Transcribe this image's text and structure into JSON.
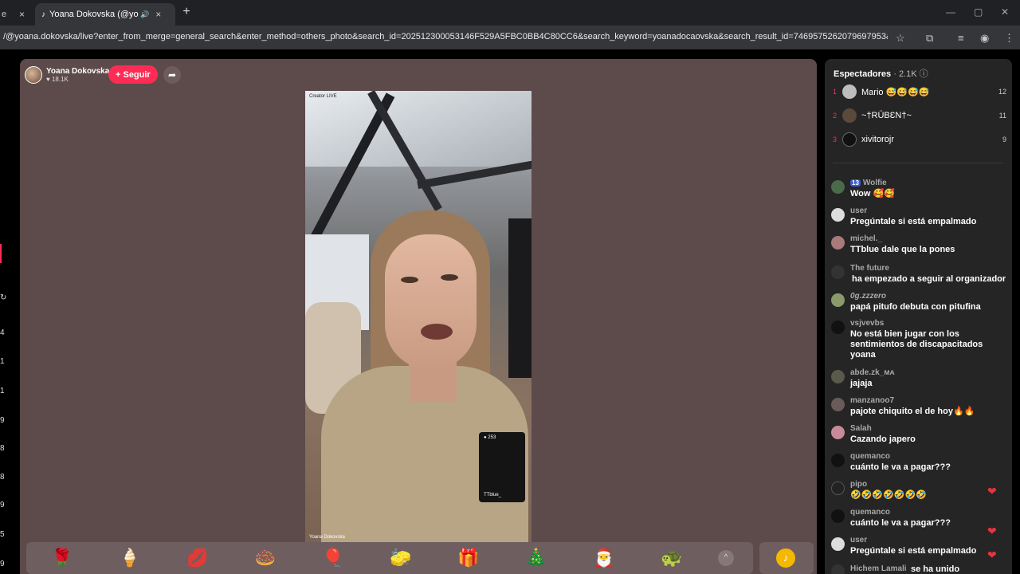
{
  "browser": {
    "tabs": [
      {
        "title": "e",
        "close": "×"
      },
      {
        "title": "Yoana Dokovska (@yoana.d",
        "close": "×",
        "audio": "🔊"
      }
    ],
    "new_tab": "+",
    "window_controls": [
      "—",
      "▢",
      "✕"
    ],
    "url": "/@yoana.dokovska/live?enter_from_merge=general_search&enter_method=others_photo&search_id=202512300053146F529A5FBC0BB4C80CC6&search_keyword=yoanadocaovska&search_result_id=7469575262079697953&search_type..."
  },
  "left_rail": [
    "4",
    "1",
    "1",
    "9",
    "8",
    "8",
    "9",
    "5",
    "9"
  ],
  "stream": {
    "host_name": "Yoana Dokovska",
    "host_likes": "♥ 18.1K",
    "follow_label": "+ Seguir",
    "video_top_label": "Creator LIVE",
    "video_bottom_label": "Yoana Dokovska",
    "guest_count": "● 253",
    "guest_name": "TTblue_"
  },
  "gifts": [
    "🌹",
    "🍦",
    "💋",
    "🍩",
    "🎈",
    "🧽",
    "🎁",
    "🎄",
    "🎅",
    "🐢"
  ],
  "gift_more": "^",
  "sidebar": {
    "title": "Espectadores",
    "count": "· 2.1K ⓘ",
    "top_viewers": [
      {
        "rank": "1",
        "name": "Mario 😅😅😅😅",
        "score": "12"
      },
      {
        "rank": "2",
        "name": "~†RÜBƐN†~",
        "score": "11"
      },
      {
        "rank": "3",
        "name": "xivitorojr",
        "score": "9"
      }
    ],
    "chat": [
      {
        "user": "Wolfie",
        "badge": "13",
        "message": "Wow 🥰🥰"
      },
      {
        "user": "user",
        "message": "Pregúntale si está empalmado"
      },
      {
        "user": "michel._",
        "message": "TTblue dale que la pones"
      },
      {
        "user": "The future",
        "message": "ha empezado a seguir al organizador"
      },
      {
        "user": "0g.zzzero",
        "message": "papá pitufo debuta con pitufina"
      },
      {
        "user": "vsjvevbs",
        "message": "No está bien jugar con los sentimientos de discapacitados yoana"
      },
      {
        "user": "abde.zk_ᴍᴀ",
        "message": "jajaja"
      },
      {
        "user": "manzanoo7",
        "message": "pajote chiquito el de hoy🔥🔥"
      },
      {
        "user": "Salah",
        "message": "Cazando japero"
      },
      {
        "user": "quemanco",
        "message": "cuánto le va a pagar???"
      },
      {
        "user": "pipo",
        "message": "🤣🤣🤣🤣🤣🤣🤣"
      },
      {
        "user": "quemanco",
        "message": "cuánto le va a pagar???"
      },
      {
        "user": "user",
        "message": "Pregúntale si está empalmado"
      },
      {
        "user": "Hichem Lamali",
        "message": "se ha unido"
      }
    ],
    "hearts": [
      "❤",
      "❤",
      "❤"
    ]
  }
}
